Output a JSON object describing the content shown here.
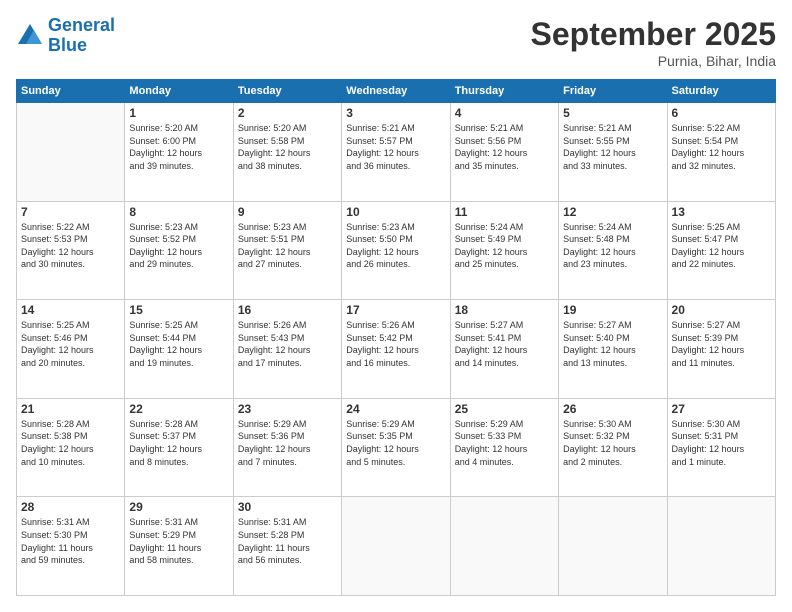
{
  "logo": {
    "line1": "General",
    "line2": "Blue"
  },
  "header": {
    "month": "September 2025",
    "location": "Purnia, Bihar, India"
  },
  "weekdays": [
    "Sunday",
    "Monday",
    "Tuesday",
    "Wednesday",
    "Thursday",
    "Friday",
    "Saturday"
  ],
  "weeks": [
    [
      {
        "day": "",
        "info": ""
      },
      {
        "day": "1",
        "info": "Sunrise: 5:20 AM\nSunset: 6:00 PM\nDaylight: 12 hours\nand 39 minutes."
      },
      {
        "day": "2",
        "info": "Sunrise: 5:20 AM\nSunset: 5:58 PM\nDaylight: 12 hours\nand 38 minutes."
      },
      {
        "day": "3",
        "info": "Sunrise: 5:21 AM\nSunset: 5:57 PM\nDaylight: 12 hours\nand 36 minutes."
      },
      {
        "day": "4",
        "info": "Sunrise: 5:21 AM\nSunset: 5:56 PM\nDaylight: 12 hours\nand 35 minutes."
      },
      {
        "day": "5",
        "info": "Sunrise: 5:21 AM\nSunset: 5:55 PM\nDaylight: 12 hours\nand 33 minutes."
      },
      {
        "day": "6",
        "info": "Sunrise: 5:22 AM\nSunset: 5:54 PM\nDaylight: 12 hours\nand 32 minutes."
      }
    ],
    [
      {
        "day": "7",
        "info": "Sunrise: 5:22 AM\nSunset: 5:53 PM\nDaylight: 12 hours\nand 30 minutes."
      },
      {
        "day": "8",
        "info": "Sunrise: 5:23 AM\nSunset: 5:52 PM\nDaylight: 12 hours\nand 29 minutes."
      },
      {
        "day": "9",
        "info": "Sunrise: 5:23 AM\nSunset: 5:51 PM\nDaylight: 12 hours\nand 27 minutes."
      },
      {
        "day": "10",
        "info": "Sunrise: 5:23 AM\nSunset: 5:50 PM\nDaylight: 12 hours\nand 26 minutes."
      },
      {
        "day": "11",
        "info": "Sunrise: 5:24 AM\nSunset: 5:49 PM\nDaylight: 12 hours\nand 25 minutes."
      },
      {
        "day": "12",
        "info": "Sunrise: 5:24 AM\nSunset: 5:48 PM\nDaylight: 12 hours\nand 23 minutes."
      },
      {
        "day": "13",
        "info": "Sunrise: 5:25 AM\nSunset: 5:47 PM\nDaylight: 12 hours\nand 22 minutes."
      }
    ],
    [
      {
        "day": "14",
        "info": "Sunrise: 5:25 AM\nSunset: 5:46 PM\nDaylight: 12 hours\nand 20 minutes."
      },
      {
        "day": "15",
        "info": "Sunrise: 5:25 AM\nSunset: 5:44 PM\nDaylight: 12 hours\nand 19 minutes."
      },
      {
        "day": "16",
        "info": "Sunrise: 5:26 AM\nSunset: 5:43 PM\nDaylight: 12 hours\nand 17 minutes."
      },
      {
        "day": "17",
        "info": "Sunrise: 5:26 AM\nSunset: 5:42 PM\nDaylight: 12 hours\nand 16 minutes."
      },
      {
        "day": "18",
        "info": "Sunrise: 5:27 AM\nSunset: 5:41 PM\nDaylight: 12 hours\nand 14 minutes."
      },
      {
        "day": "19",
        "info": "Sunrise: 5:27 AM\nSunset: 5:40 PM\nDaylight: 12 hours\nand 13 minutes."
      },
      {
        "day": "20",
        "info": "Sunrise: 5:27 AM\nSunset: 5:39 PM\nDaylight: 12 hours\nand 11 minutes."
      }
    ],
    [
      {
        "day": "21",
        "info": "Sunrise: 5:28 AM\nSunset: 5:38 PM\nDaylight: 12 hours\nand 10 minutes."
      },
      {
        "day": "22",
        "info": "Sunrise: 5:28 AM\nSunset: 5:37 PM\nDaylight: 12 hours\nand 8 minutes."
      },
      {
        "day": "23",
        "info": "Sunrise: 5:29 AM\nSunset: 5:36 PM\nDaylight: 12 hours\nand 7 minutes."
      },
      {
        "day": "24",
        "info": "Sunrise: 5:29 AM\nSunset: 5:35 PM\nDaylight: 12 hours\nand 5 minutes."
      },
      {
        "day": "25",
        "info": "Sunrise: 5:29 AM\nSunset: 5:33 PM\nDaylight: 12 hours\nand 4 minutes."
      },
      {
        "day": "26",
        "info": "Sunrise: 5:30 AM\nSunset: 5:32 PM\nDaylight: 12 hours\nand 2 minutes."
      },
      {
        "day": "27",
        "info": "Sunrise: 5:30 AM\nSunset: 5:31 PM\nDaylight: 12 hours\nand 1 minute."
      }
    ],
    [
      {
        "day": "28",
        "info": "Sunrise: 5:31 AM\nSunset: 5:30 PM\nDaylight: 11 hours\nand 59 minutes."
      },
      {
        "day": "29",
        "info": "Sunrise: 5:31 AM\nSunset: 5:29 PM\nDaylight: 11 hours\nand 58 minutes."
      },
      {
        "day": "30",
        "info": "Sunrise: 5:31 AM\nSunset: 5:28 PM\nDaylight: 11 hours\nand 56 minutes."
      },
      {
        "day": "",
        "info": ""
      },
      {
        "day": "",
        "info": ""
      },
      {
        "day": "",
        "info": ""
      },
      {
        "day": "",
        "info": ""
      }
    ]
  ]
}
